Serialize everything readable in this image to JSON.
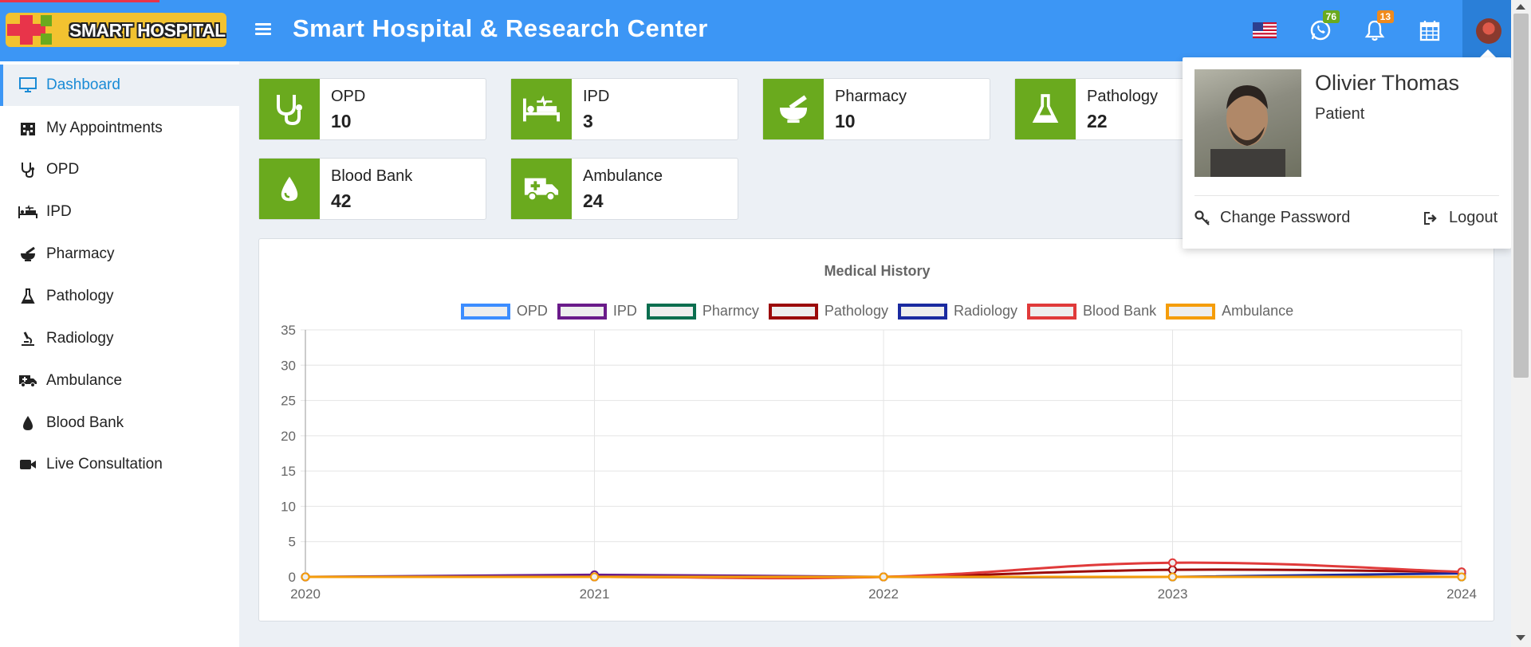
{
  "header": {
    "logo_text": "SMART HOSPITAL",
    "app_title": "Smart Hospital & Research Center",
    "whatsapp_badge": "76",
    "notification_badge": "13",
    "flag_icon": "us-flag-icon",
    "accent_color": "#3c96f5"
  },
  "sidebar": {
    "items": [
      {
        "label": "Dashboard",
        "icon": "monitor-icon"
      },
      {
        "label": "My Appointments",
        "icon": "hospital-building-icon"
      },
      {
        "label": "OPD",
        "icon": "stethoscope-icon"
      },
      {
        "label": "IPD",
        "icon": "hospital-bed-icon"
      },
      {
        "label": "Pharmacy",
        "icon": "mortar-pestle-icon"
      },
      {
        "label": "Pathology",
        "icon": "flask-icon"
      },
      {
        "label": "Radiology",
        "icon": "microscope-icon"
      },
      {
        "label": "Ambulance",
        "icon": "ambulance-icon"
      },
      {
        "label": "Blood Bank",
        "icon": "blood-drop-icon"
      },
      {
        "label": "Live Consultation",
        "icon": "video-camera-icon"
      }
    ]
  },
  "cards": [
    {
      "label": "OPD",
      "value": "10",
      "icon": "stethoscope-icon"
    },
    {
      "label": "IPD",
      "value": "3",
      "icon": "hospital-bed-icon"
    },
    {
      "label": "Pharmacy",
      "value": "10",
      "icon": "mortar-pestle-icon"
    },
    {
      "label": "Pathology",
      "value": "22",
      "icon": "flask-icon"
    },
    {
      "label": "Blood Bank",
      "value": "42",
      "icon": "blood-drop-icon"
    },
    {
      "label": "Ambulance",
      "value": "24",
      "icon": "ambulance-icon"
    }
  ],
  "profile": {
    "name": "Olivier Thomas",
    "role": "Patient",
    "change_password": "Change Password",
    "logout": "Logout"
  },
  "chart_data": {
    "type": "line",
    "title": "Medical History",
    "x": [
      "2020",
      "2021",
      "2022",
      "2023",
      "2024"
    ],
    "ylim": [
      0,
      35
    ],
    "yticks": [
      0,
      5,
      10,
      15,
      20,
      25,
      30,
      35
    ],
    "grid": true,
    "legend_position": "top-center",
    "series": [
      {
        "name": "OPD",
        "color": "#3c8dff",
        "values": [
          0,
          0,
          0,
          0,
          0
        ]
      },
      {
        "name": "IPD",
        "color": "#6a1b8a",
        "values": [
          0,
          0.3,
          0,
          0,
          0
        ]
      },
      {
        "name": "Pharmcy",
        "color": "#0b6e4f",
        "values": [
          0,
          0,
          0,
          0,
          0
        ]
      },
      {
        "name": "Pathology",
        "color": "#9b0a0a",
        "values": [
          0,
          0,
          0,
          1,
          0.7
        ]
      },
      {
        "name": "Radiology",
        "color": "#1a2aa0",
        "values": [
          0,
          0,
          0,
          0,
          0.5
        ]
      },
      {
        "name": "Blood Bank",
        "color": "#e03a3a",
        "values": [
          0,
          0,
          0,
          2,
          0.7
        ]
      },
      {
        "name": "Ambulance",
        "color": "#f59d0a",
        "values": [
          0,
          0,
          0,
          0,
          0
        ]
      }
    ]
  }
}
